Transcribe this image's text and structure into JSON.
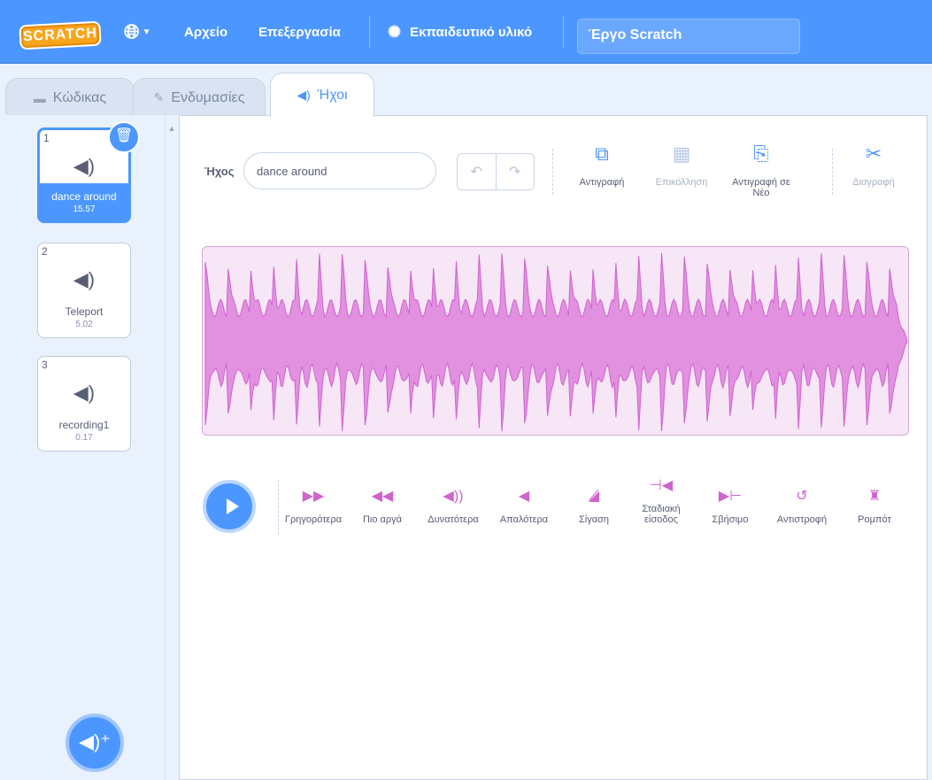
{
  "menubar": {
    "logo": "SCRATCH",
    "file": "Αρχείο",
    "edit": "Επεξεργασία",
    "tutorials": "Εκπαιδευτικό υλικό",
    "project_title": "Έργο Scratch"
  },
  "tabs": {
    "code": "Κώδικας",
    "costumes": "Ενδυμασίες",
    "sounds": "Ήχοι"
  },
  "sounds": [
    {
      "number": "1",
      "name": "dance around",
      "duration": "15.57",
      "selected": true
    },
    {
      "number": "2",
      "name": "Teleport",
      "duration": "5.02",
      "selected": false
    },
    {
      "number": "3",
      "name": "recording1",
      "duration": "0.17",
      "selected": false
    }
  ],
  "editor": {
    "sound_label": "Ήχος",
    "sound_name": "dance around",
    "tools": {
      "copy": "Αντιγραφή",
      "paste": "Επικόλληση",
      "copy_to_new_1": "Αντιγραφή σε",
      "copy_to_new_2": "Νέο",
      "delete": "Διαγραφή"
    },
    "effects": {
      "faster": "Γρηγορότερα",
      "slower": "Πιο αργά",
      "louder": "Δυνατότερα",
      "softer": "Απαλότερα",
      "mute": "Σίγαση",
      "fade_in_1": "Σταδιακή",
      "fade_in_2": "είσοδος",
      "fade_out": "Σβήσιμο",
      "reverse": "Αντιστροφή",
      "robot": "Ρομπότ"
    }
  },
  "colors": {
    "accent": "#4c97ff",
    "sound": "#cf63cf",
    "waveform_fill": "#e290e0"
  },
  "icons": {
    "globe": "globe-icon",
    "bulb": "lightbulb-icon",
    "speaker": "speaker-icon",
    "trash": "trash-icon",
    "scissors": "scissors-icon"
  }
}
